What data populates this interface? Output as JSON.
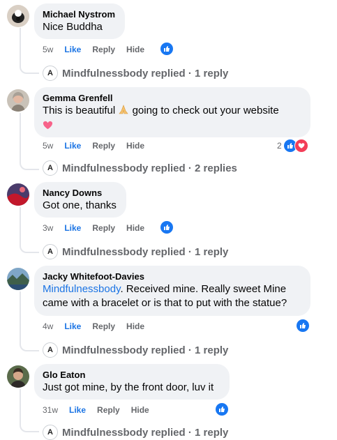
{
  "comments": [
    {
      "name": "Michael Nystrom",
      "text": "Nice Buddha",
      "time": "5w",
      "reply_summary": "Mindfulnessbody replied · 1 reply"
    },
    {
      "name": "Gemma Grenfell",
      "text_before_emoji": "This is beautiful",
      "text_after_emoji": "going to check out your website",
      "time": "5w",
      "reaction_count": "2",
      "reply_summary": "Mindfulnessbody replied · 2 replies"
    },
    {
      "name": "Nancy Downs",
      "text": "Got one, thanks",
      "time": "3w",
      "reply_summary": "Mindfulnessbody replied · 1 reply"
    },
    {
      "name": "Jacky Whitefoot-Davies",
      "mention": "Mindfulnessbody",
      "text_line1": ". Received mine. Really sweet Mine",
      "text_line2": "came with a bracelet or is that to put with the statue?",
      "time": "4w",
      "reply_summary": "Mindfulnessbody replied · 1 reply"
    },
    {
      "name": "Glo Eaton",
      "text": "Just got mine, by the front door, luv it",
      "time": "31w",
      "reply_summary": "Mindfulnessbody replied · 1 reply"
    }
  ],
  "actions": {
    "like": "Like",
    "reply": "Reply",
    "hide": "Hide"
  },
  "reply_avatar_letter": "A",
  "colors": {
    "accent": "#1877f2",
    "love": "#f33e58",
    "bubble": "#f0f2f5",
    "muted": "#65676b"
  },
  "icons": [
    "like-icon",
    "love-icon",
    "folded-hands-emoji",
    "heart-emoji"
  ]
}
